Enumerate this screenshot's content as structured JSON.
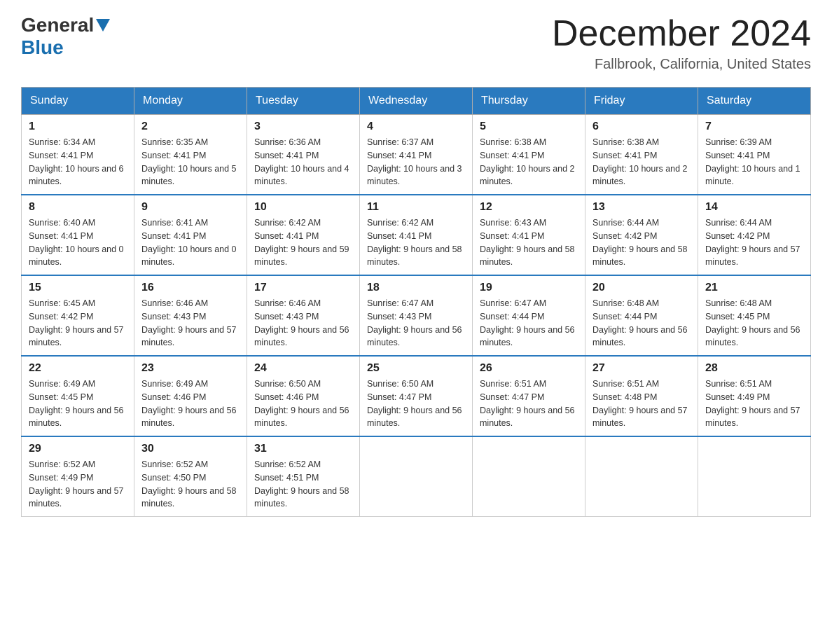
{
  "logo": {
    "general": "General",
    "blue": "Blue"
  },
  "header": {
    "month_year": "December 2024",
    "location": "Fallbrook, California, United States"
  },
  "weekdays": [
    "Sunday",
    "Monday",
    "Tuesday",
    "Wednesday",
    "Thursday",
    "Friday",
    "Saturday"
  ],
  "weeks": [
    [
      {
        "day": 1,
        "sunrise": "6:34 AM",
        "sunset": "4:41 PM",
        "daylight": "10 hours and 6 minutes."
      },
      {
        "day": 2,
        "sunrise": "6:35 AM",
        "sunset": "4:41 PM",
        "daylight": "10 hours and 5 minutes."
      },
      {
        "day": 3,
        "sunrise": "6:36 AM",
        "sunset": "4:41 PM",
        "daylight": "10 hours and 4 minutes."
      },
      {
        "day": 4,
        "sunrise": "6:37 AM",
        "sunset": "4:41 PM",
        "daylight": "10 hours and 3 minutes."
      },
      {
        "day": 5,
        "sunrise": "6:38 AM",
        "sunset": "4:41 PM",
        "daylight": "10 hours and 2 minutes."
      },
      {
        "day": 6,
        "sunrise": "6:38 AM",
        "sunset": "4:41 PM",
        "daylight": "10 hours and 2 minutes."
      },
      {
        "day": 7,
        "sunrise": "6:39 AM",
        "sunset": "4:41 PM",
        "daylight": "10 hours and 1 minute."
      }
    ],
    [
      {
        "day": 8,
        "sunrise": "6:40 AM",
        "sunset": "4:41 PM",
        "daylight": "10 hours and 0 minutes."
      },
      {
        "day": 9,
        "sunrise": "6:41 AM",
        "sunset": "4:41 PM",
        "daylight": "10 hours and 0 minutes."
      },
      {
        "day": 10,
        "sunrise": "6:42 AM",
        "sunset": "4:41 PM",
        "daylight": "9 hours and 59 minutes."
      },
      {
        "day": 11,
        "sunrise": "6:42 AM",
        "sunset": "4:41 PM",
        "daylight": "9 hours and 58 minutes."
      },
      {
        "day": 12,
        "sunrise": "6:43 AM",
        "sunset": "4:41 PM",
        "daylight": "9 hours and 58 minutes."
      },
      {
        "day": 13,
        "sunrise": "6:44 AM",
        "sunset": "4:42 PM",
        "daylight": "9 hours and 58 minutes."
      },
      {
        "day": 14,
        "sunrise": "6:44 AM",
        "sunset": "4:42 PM",
        "daylight": "9 hours and 57 minutes."
      }
    ],
    [
      {
        "day": 15,
        "sunrise": "6:45 AM",
        "sunset": "4:42 PM",
        "daylight": "9 hours and 57 minutes."
      },
      {
        "day": 16,
        "sunrise": "6:46 AM",
        "sunset": "4:43 PM",
        "daylight": "9 hours and 57 minutes."
      },
      {
        "day": 17,
        "sunrise": "6:46 AM",
        "sunset": "4:43 PM",
        "daylight": "9 hours and 56 minutes."
      },
      {
        "day": 18,
        "sunrise": "6:47 AM",
        "sunset": "4:43 PM",
        "daylight": "9 hours and 56 minutes."
      },
      {
        "day": 19,
        "sunrise": "6:47 AM",
        "sunset": "4:44 PM",
        "daylight": "9 hours and 56 minutes."
      },
      {
        "day": 20,
        "sunrise": "6:48 AM",
        "sunset": "4:44 PM",
        "daylight": "9 hours and 56 minutes."
      },
      {
        "day": 21,
        "sunrise": "6:48 AM",
        "sunset": "4:45 PM",
        "daylight": "9 hours and 56 minutes."
      }
    ],
    [
      {
        "day": 22,
        "sunrise": "6:49 AM",
        "sunset": "4:45 PM",
        "daylight": "9 hours and 56 minutes."
      },
      {
        "day": 23,
        "sunrise": "6:49 AM",
        "sunset": "4:46 PM",
        "daylight": "9 hours and 56 minutes."
      },
      {
        "day": 24,
        "sunrise": "6:50 AM",
        "sunset": "4:46 PM",
        "daylight": "9 hours and 56 minutes."
      },
      {
        "day": 25,
        "sunrise": "6:50 AM",
        "sunset": "4:47 PM",
        "daylight": "9 hours and 56 minutes."
      },
      {
        "day": 26,
        "sunrise": "6:51 AM",
        "sunset": "4:47 PM",
        "daylight": "9 hours and 56 minutes."
      },
      {
        "day": 27,
        "sunrise": "6:51 AM",
        "sunset": "4:48 PM",
        "daylight": "9 hours and 57 minutes."
      },
      {
        "day": 28,
        "sunrise": "6:51 AM",
        "sunset": "4:49 PM",
        "daylight": "9 hours and 57 minutes."
      }
    ],
    [
      {
        "day": 29,
        "sunrise": "6:52 AM",
        "sunset": "4:49 PM",
        "daylight": "9 hours and 57 minutes."
      },
      {
        "day": 30,
        "sunrise": "6:52 AM",
        "sunset": "4:50 PM",
        "daylight": "9 hours and 58 minutes."
      },
      {
        "day": 31,
        "sunrise": "6:52 AM",
        "sunset": "4:51 PM",
        "daylight": "9 hours and 58 minutes."
      },
      null,
      null,
      null,
      null
    ]
  ],
  "labels": {
    "sunrise": "Sunrise:",
    "sunset": "Sunset:",
    "daylight": "Daylight:"
  }
}
